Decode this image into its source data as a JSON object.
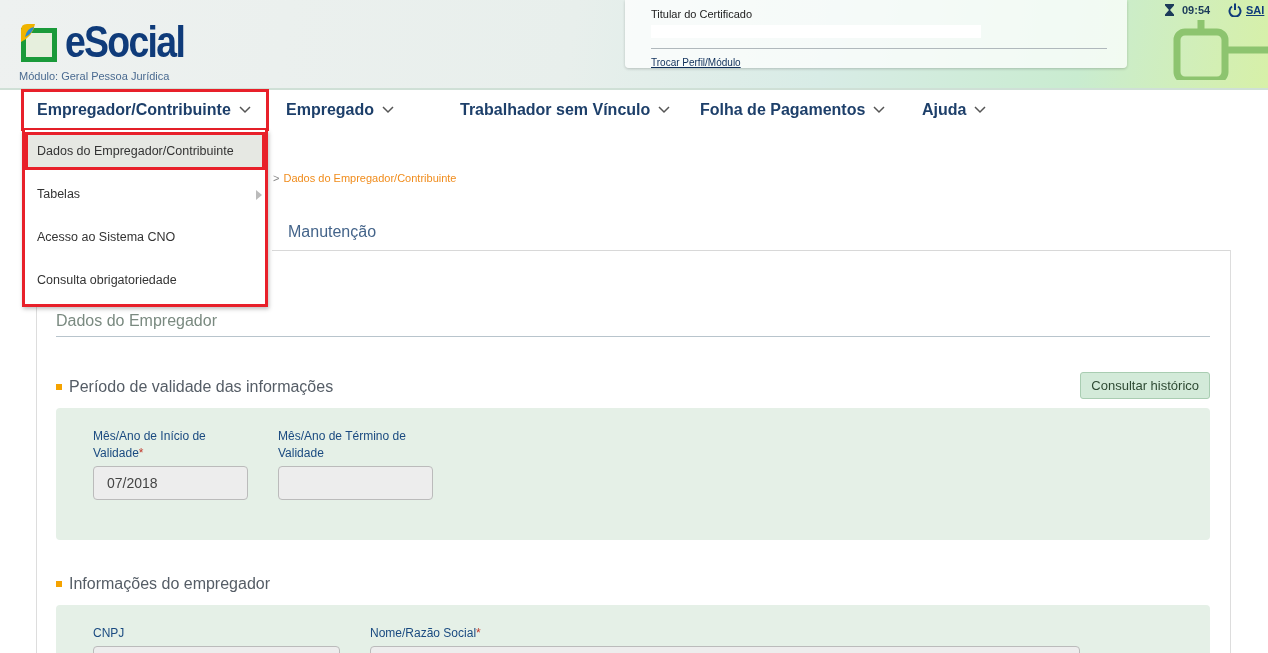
{
  "header": {
    "logo": "eSocial",
    "module": "Módulo: Geral Pessoa Jurídica",
    "certificate": {
      "title": "Titular do Certificado",
      "link": "Trocar Perfil/Módulo"
    },
    "time": "09:54",
    "logout": "SAI"
  },
  "nav": [
    {
      "label": "Empregador/Contribuinte",
      "highlighted": true
    },
    {
      "label": "Empregado",
      "highlighted": false
    },
    {
      "label": "Trabalhador sem Vínculo",
      "highlighted": false
    },
    {
      "label": "Folha de Pagamentos",
      "highlighted": false
    },
    {
      "label": "Ajuda",
      "highlighted": false
    }
  ],
  "menu": [
    {
      "label": "Dados do Empregador/Contribuinte",
      "selected": true,
      "submenu": false
    },
    {
      "label": "Tabelas",
      "selected": false,
      "submenu": true
    },
    {
      "label": "Acesso ao Sistema CNO",
      "selected": false,
      "submenu": false
    },
    {
      "label": "Consulta obrigatoriedade",
      "selected": false,
      "submenu": false
    }
  ],
  "breadcrumb": {
    "separator": ">",
    "current": "Dados do Empregador/Contribuinte"
  },
  "tabs": [
    {
      "label": "Manutenção",
      "selected": true
    }
  ],
  "page_title": "Dados do Empregador",
  "sections": [
    {
      "title": "Período de validade das informações",
      "button": "Consultar histórico",
      "fields": [
        {
          "label": "Mês/Ano de Início de Validade",
          "required_mark": "*",
          "value": "07/2018"
        },
        {
          "label": "Mês/Ano de Término de Validade"
        }
      ]
    },
    {
      "title": "Informações do empregador",
      "fields": [
        {
          "label": "CNPJ"
        },
        {
          "label": "Nome/Razão Social",
          "required_mark": "*"
        }
      ]
    }
  ]
}
